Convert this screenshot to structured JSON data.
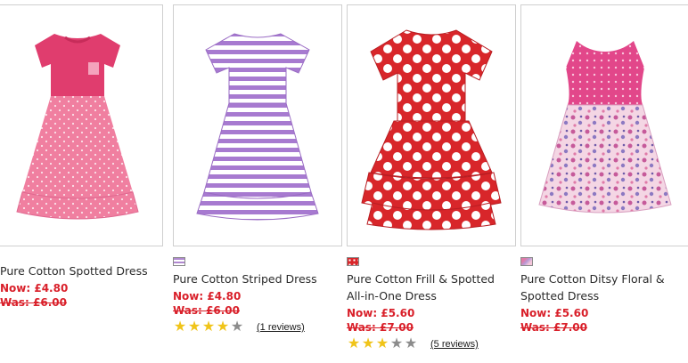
{
  "products": [
    {
      "name": "Pure Cotton Spotted Dress",
      "now": "Now: £4.80",
      "was": "Was: £6.00",
      "swatch_color": "",
      "rating": 0,
      "reviews": "",
      "image": "pink-spotted-dress"
    },
    {
      "name": "Pure Cotton Striped Dress",
      "now": "Now: £4.80",
      "was": "Was: £6.00",
      "swatch_color": "#b088d0",
      "rating": 4,
      "reviews": "(1 reviews)",
      "image": "purple-striped-dress"
    },
    {
      "name_line1": "Pure Cotton Frill & Spotted",
      "name_line2": "All-in-One Dress",
      "now": "Now: £5.60",
      "was": "Was: £7.00",
      "swatch_color": "#d8262a",
      "rating": 3,
      "reviews": "(5 reviews)",
      "image": "red-polka-frill-dress"
    },
    {
      "name_line1": "Pure Cotton Ditsy Floral &",
      "name_line2": "Spotted Dress",
      "now": "Now: £5.60",
      "was": "Was: £7.00",
      "swatch_color": "#e07aa8",
      "rating": 0,
      "reviews": "",
      "image": "pink-floral-dress"
    }
  ]
}
